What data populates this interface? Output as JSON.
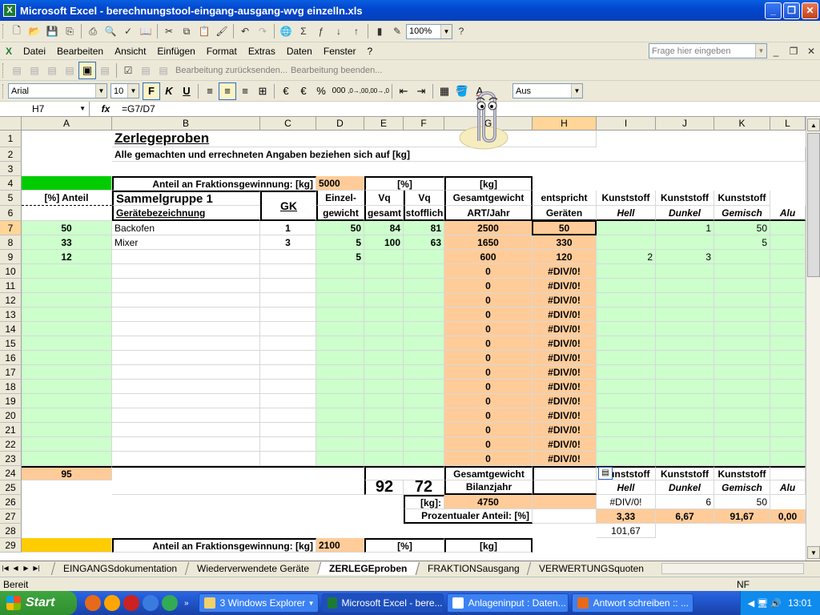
{
  "window": {
    "title": "Microsoft Excel - berechnungstool-eingang-ausgang-wvg einzelln.xls"
  },
  "menu": [
    "Datei",
    "Bearbeiten",
    "Ansicht",
    "Einfügen",
    "Format",
    "Extras",
    "Daten",
    "Fenster",
    "?"
  ],
  "help_box": {
    "placeholder": "Frage hier eingeben"
  },
  "toolbar": {
    "zoom": "100%"
  },
  "review_bar": {
    "finish_review": "Bearbeitung zurücksenden...",
    "end_review": "Bearbeitung beenden..."
  },
  "format_bar": {
    "font": "Arial",
    "size": "10",
    "bold_label": "F",
    "italic_label": "K",
    "underline_label": "U",
    "currency": "€",
    "percent": "%",
    "thousands": "000",
    "inc_dec": ",0→,00",
    "dec_dec": ",00→,0",
    "style": "Aus"
  },
  "formula_bar": {
    "name_box": "H7",
    "fx": "fx",
    "formula": "=G7/D7"
  },
  "columns": [
    "A",
    "B",
    "C",
    "D",
    "E",
    "F",
    "G",
    "H",
    "I",
    "J",
    "K",
    "L"
  ],
  "rows": [
    "1",
    "2",
    "3",
    "4",
    "5",
    "6",
    "7",
    "8",
    "9",
    "10",
    "11",
    "12",
    "13",
    "14",
    "15",
    "16",
    "17",
    "18",
    "19",
    "20",
    "21",
    "22",
    "23",
    "24",
    "25",
    "26",
    "27",
    "28",
    "29"
  ],
  "sheet": {
    "title": "Zerlegeproben",
    "subtitle": "Alle gemachten und errechneten Angaben beziehen sich auf [kg]",
    "r4": {
      "label": "Anteil an Fraktionsgewinnung: [kg]",
      "value": "5000",
      "e": "[%]",
      "g": "[kg]"
    },
    "r5": {
      "a": "[%] Anteil",
      "b": "Sammelgruppe 1",
      "c": "GK",
      "d": "Einzel-",
      "e": "Vq",
      "f": "Vq",
      "g": "Gesamtgewicht",
      "h": "entspricht",
      "i": "Kunststoff",
      "j": "Kunststoff",
      "k": "Kunststoff"
    },
    "r6": {
      "b": "Gerätebezeichnung",
      "d": "gewicht",
      "e": "gesamt",
      "f": "stofflich",
      "g": "ART/Jahr",
      "h": "Geräten",
      "i": "Hell",
      "j": "Dunkel",
      "k": "Gemisch",
      "l": "Alu"
    },
    "r7": {
      "a": "50",
      "b": "Backofen",
      "c": "1",
      "d": "50",
      "e": "84",
      "f": "81",
      "g": "2500",
      "h": "50",
      "j": "1",
      "k": "50"
    },
    "r8": {
      "a": "33",
      "b": "Mixer",
      "c": "3",
      "d": "5",
      "e": "100",
      "f": "63",
      "g": "1650",
      "h": "330",
      "k": "5"
    },
    "r9": {
      "a": "12",
      "d": "5",
      "g": "600",
      "h": "120",
      "i": "2",
      "j": "3"
    },
    "zero": "0",
    "divzero": "#DIV/0!",
    "r24": {
      "a": "95",
      "g": "Gesamtgewicht",
      "i": "Kunststoff",
      "j": "Kunststoff",
      "k": "Kunststoff"
    },
    "r25": {
      "e": "92",
      "f": "72",
      "g": "Bilanzjahr",
      "i": "Hell",
      "j": "Dunkel",
      "k": "Gemisch",
      "l": "Alu"
    },
    "r26": {
      "f": "[kg]:",
      "g": "4750",
      "i": "#DIV/0!",
      "j": "6",
      "k": "50"
    },
    "r27": {
      "label": "Prozentualer Anteil: [%]",
      "i": "3,33",
      "j": "6,67",
      "k": "91,67",
      "l": "0,00"
    },
    "r28": {
      "i": "101,67"
    },
    "r29": {
      "label": "Anteil an Fraktionsgewinnung: [kg]",
      "value": "2100",
      "e": "[%]",
      "g": "[kg]"
    }
  },
  "sheet_tabs": [
    "EINGANGSdokumentation",
    "Wiederverwendete Geräte",
    "ZERLEGEproben",
    "FRAKTIONSausgang",
    "VERWERTUNGSquoten"
  ],
  "status": {
    "left": "Bereit",
    "right": "NF"
  },
  "taskbar": {
    "start": "Start",
    "tasks": [
      "3 Windows Explorer",
      "Microsoft Excel - bere...",
      "Anlageninput : Daten...",
      "Antwort schreiben :: ..."
    ],
    "clock": "13:01"
  }
}
